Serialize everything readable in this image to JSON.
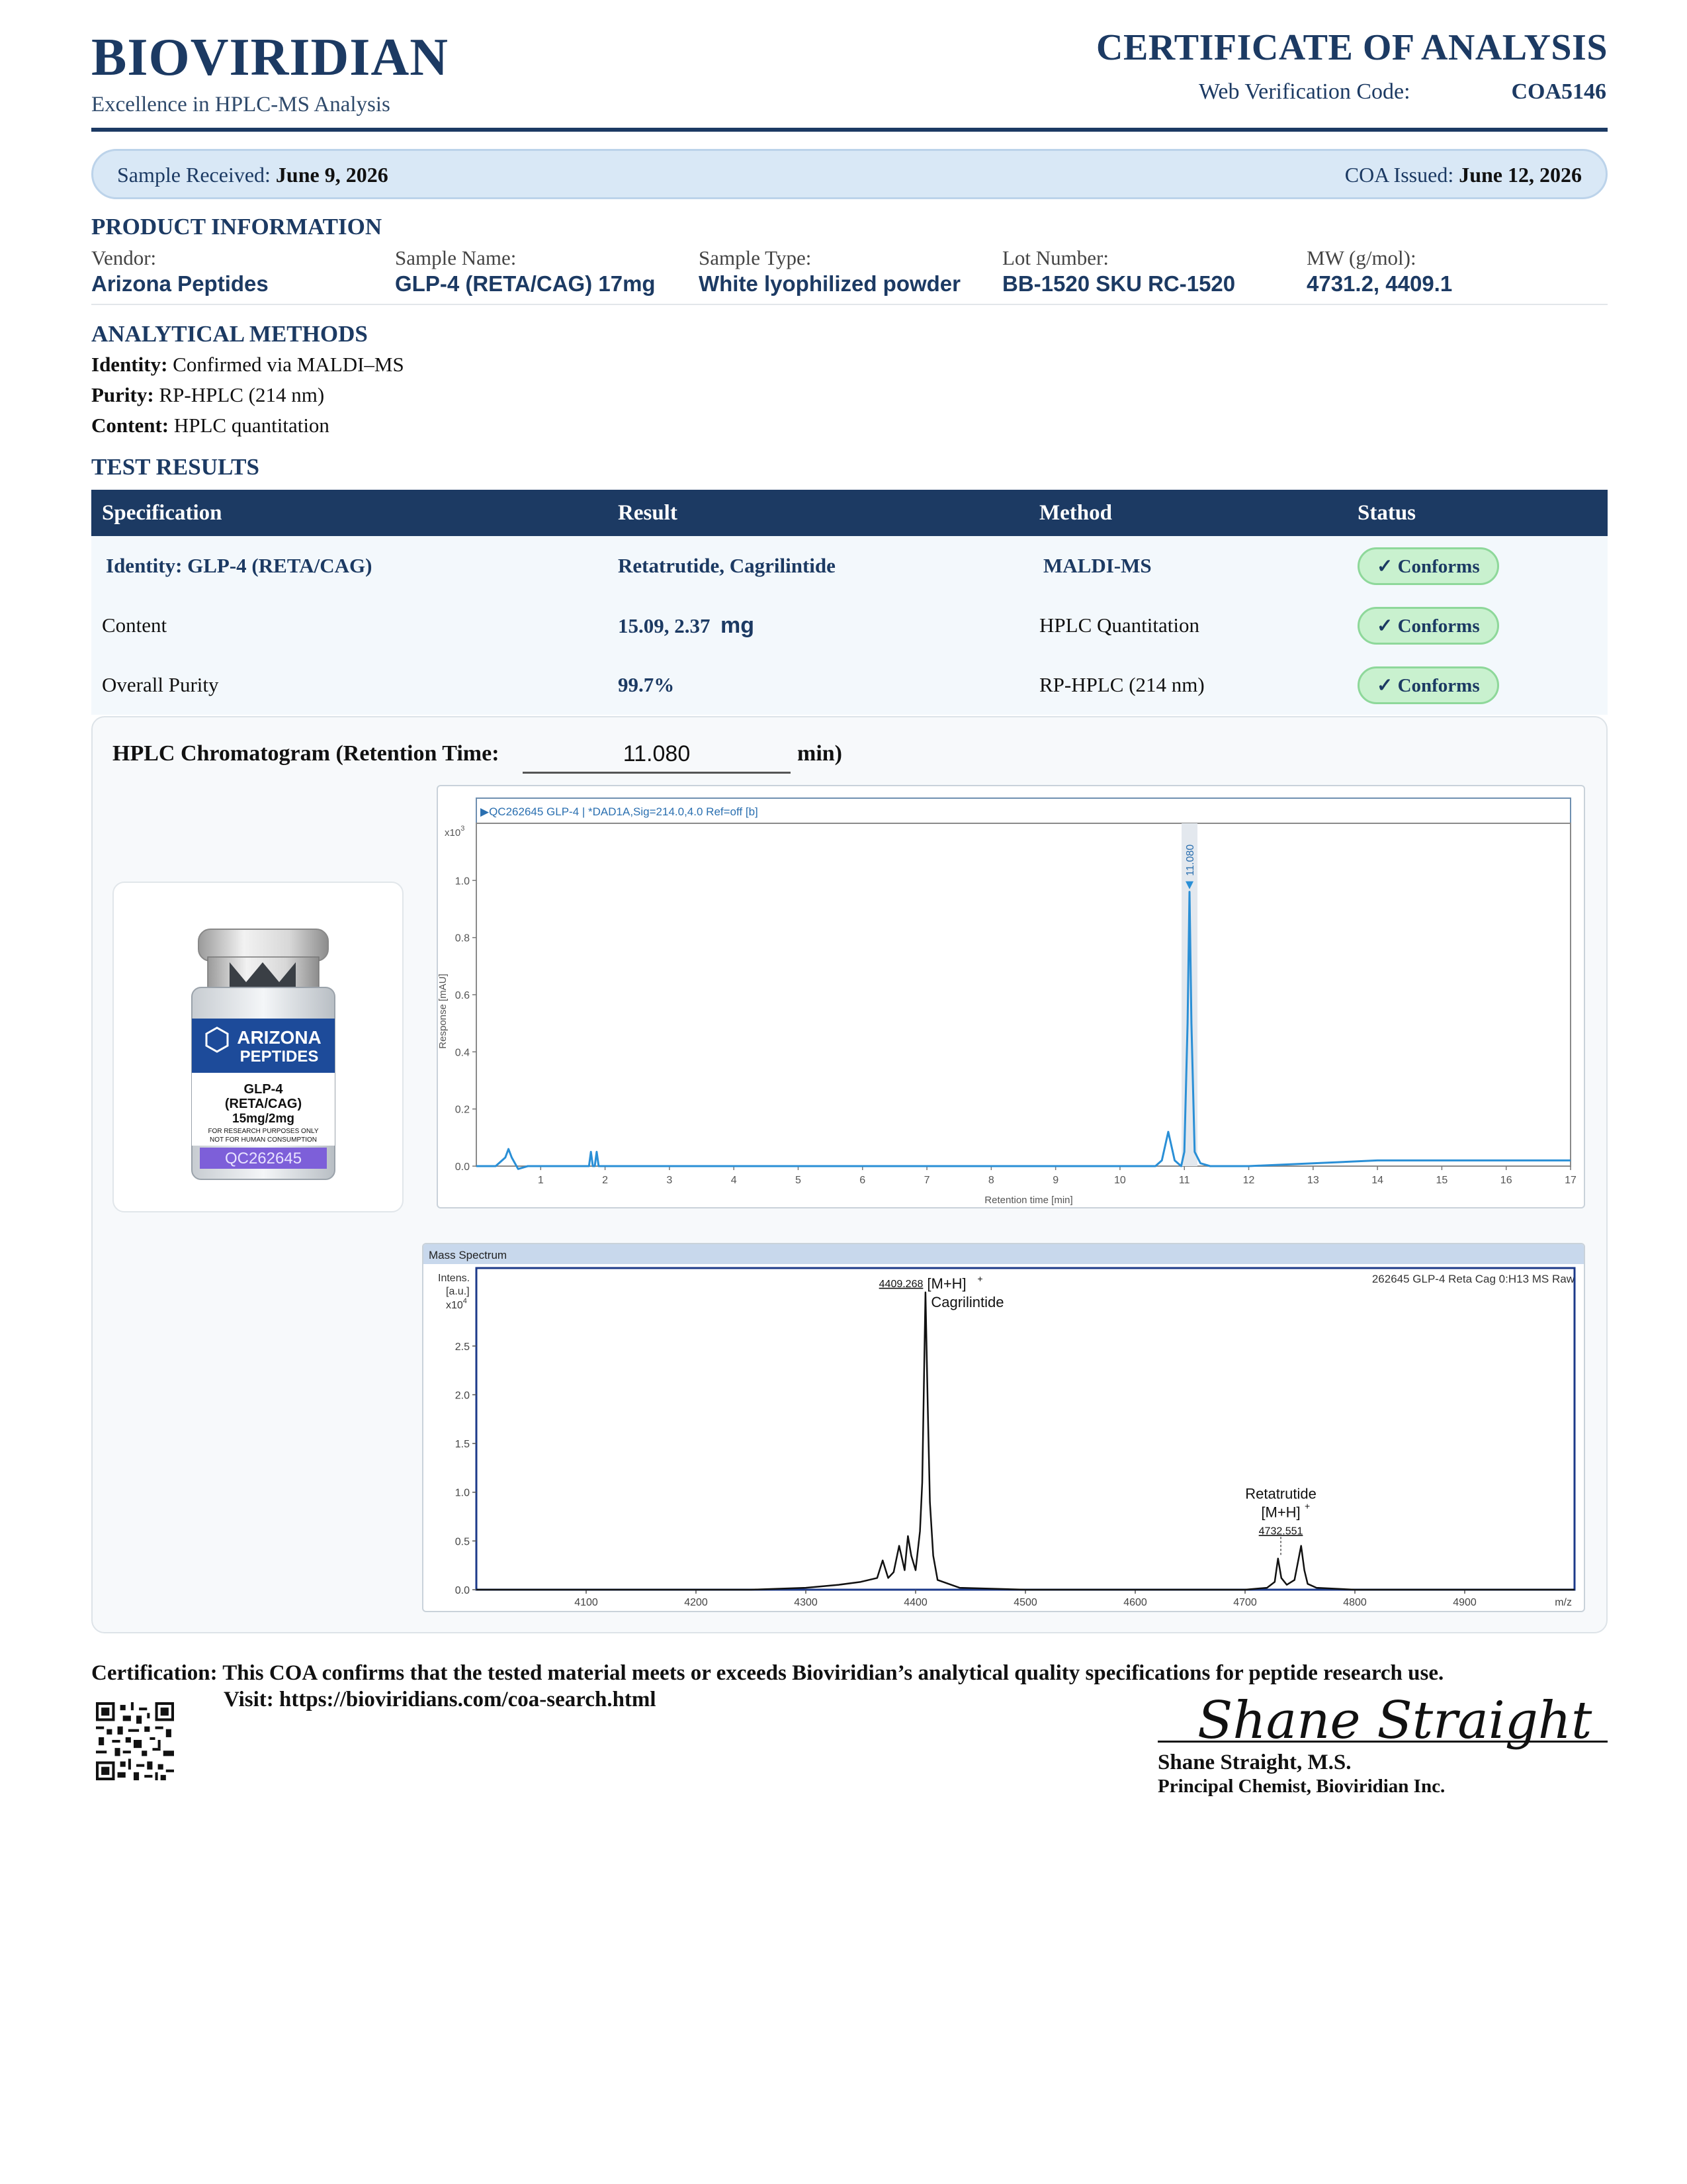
{
  "header": {
    "brand": "BIOVIRIDIAN",
    "tagline": "Excellence in HPLC-MS Analysis",
    "doc_title": "CERTIFICATE OF ANALYSIS",
    "verification_label": "Web Verification Code:",
    "verification_code": "COA5146",
    "brand_color": "#1c3a63"
  },
  "dates": {
    "received_label": "Sample Received:",
    "received_value": "June 9, 2026",
    "issued_label": "COA Issued:",
    "issued_value": "June 12, 2026"
  },
  "product_info": {
    "title": "PRODUCT INFORMATION",
    "fields": [
      {
        "label": "Vendor:",
        "value": "Arizona Peptides"
      },
      {
        "label": "Sample Name:",
        "value": "GLP-4 (RETA/CAG) 17mg"
      },
      {
        "label": "Sample Type:",
        "value": "White lyophilized powder"
      },
      {
        "label": "Lot Number:",
        "value": "BB-1520 SKU RC-1520"
      },
      {
        "label": "MW (g/mol):",
        "value": "4731.2, 4409.1"
      }
    ]
  },
  "methods": {
    "title": "ANALYTICAL METHODS",
    "items": [
      {
        "label": "Identity:",
        "value": "Confirmed via MALDI–MS"
      },
      {
        "label": "Purity:",
        "value": "RP-HPLC (214 nm)"
      },
      {
        "label": "Content:",
        "value": "HPLC quantitation"
      }
    ]
  },
  "results": {
    "title": "TEST RESULTS",
    "headers": [
      "Specification",
      "Result",
      "Method",
      "Status"
    ],
    "rows": [
      {
        "spec": "Identity:  GLP-4 (RETA/CAG)",
        "result": "Retatrutide, Cagrilintide",
        "unit": "",
        "method": "MALDI-MS",
        "status": "Conforms"
      },
      {
        "spec": "Content",
        "result": "15.09, 2.37",
        "unit": "mg",
        "method": "HPLC Quantitation",
        "status": "Conforms"
      },
      {
        "spec": "Overall Purity",
        "result": "99.7%",
        "unit": "",
        "method": "RP-HPLC (214 nm)",
        "status": "Conforms"
      }
    ],
    "check_glyph": "✓",
    "status_color": "#c9f1cf"
  },
  "chromatogram": {
    "title": "HPLC Chromatogram (Retention Time:",
    "retention_time": "11.080",
    "unit": "min)"
  },
  "vial": {
    "brand_line1": "ARIZONA",
    "brand_line2": "PEPTIDES",
    "product_line1": "GLP-4",
    "product_line2": "(RETA/CAG)",
    "dose": "15mg/2mg",
    "disclaimer1": "FOR RESEARCH PURPOSES ONLY",
    "disclaimer2": "NOT FOR HUMAN CONSUMPTION",
    "lot_code": "QC262645"
  },
  "chart_data": [
    {
      "type": "line",
      "header_text": "▶QC262645 GLP-4 | *DAD1A,Sig=214.0,4.0 Ref=off [b]",
      "ylabel": "Response [mAU]",
      "xlabel": "Retention time [min]",
      "y_multiplier": "x10",
      "y_exponent": "3",
      "xlim": [
        0,
        17
      ],
      "ylim": [
        0,
        1.2
      ],
      "x_ticks": [
        1,
        2,
        3,
        4,
        5,
        6,
        7,
        8,
        9,
        10,
        11,
        12,
        13,
        14,
        15,
        16,
        17
      ],
      "y_ticks": [
        0.0,
        0.2,
        0.4,
        0.6,
        0.8,
        1.0
      ],
      "y_tick_labels": [
        "0.0",
        "0.2",
        "0.4",
        "0.6",
        "0.8",
        "1.0"
      ],
      "peak_label": "11.080",
      "line_color": "#2a8fd6",
      "series": [
        {
          "x": [
            0,
            0.3,
            0.45,
            0.5,
            0.55,
            0.65,
            0.8,
            1.5,
            1.75,
            1.78,
            1.81,
            1.84,
            1.87,
            1.9,
            1.95,
            2.5,
            3.5,
            4.5,
            5.5,
            6.5,
            7.5,
            8.5,
            9.5,
            10.3,
            10.55,
            10.65,
            10.75,
            10.85,
            10.95,
            11.0,
            11.05,
            11.08,
            11.11,
            11.16,
            11.25,
            11.4,
            12,
            13,
            14,
            15,
            16,
            17
          ],
          "y": [
            0.0,
            0.0,
            0.03,
            0.06,
            0.03,
            -0.01,
            0.0,
            0.0,
            0.0,
            0.05,
            0.0,
            0.0,
            0.05,
            0.0,
            0.0,
            0.0,
            0.0,
            0.0,
            0.0,
            0.0,
            0.0,
            0.0,
            0.0,
            0.0,
            0.0,
            0.02,
            0.12,
            0.02,
            0.0,
            0.05,
            0.5,
            0.96,
            0.5,
            0.05,
            0.01,
            0.0,
            0.0,
            0.01,
            0.02,
            0.02,
            0.02,
            0.02
          ]
        }
      ]
    },
    {
      "type": "line",
      "header_text": "Mass Spectrum",
      "sample_label": "262645 GLP-4 Reta Cag 0:H13 MS Raw",
      "ylabel_line1": "Intens.",
      "ylabel_line2": "[a.u.]",
      "y_multiplier": "x10",
      "y_exponent": "4",
      "xlabel": "m/z",
      "xlim": [
        4000,
        5000
      ],
      "ylim": [
        0,
        3.3
      ],
      "x_ticks": [
        4100,
        4200,
        4300,
        4400,
        4500,
        4600,
        4700,
        4800,
        4900
      ],
      "y_ticks": [
        0.0,
        0.5,
        1.0,
        1.5,
        2.0,
        2.5
      ],
      "y_tick_labels": [
        "0.0",
        "0.5",
        "1.0",
        "1.5",
        "2.0",
        "2.5"
      ],
      "line_color": "#111111",
      "annotations": [
        {
          "mz": "4409.268",
          "ion": "[M+H]",
          "charge": "+",
          "name": "Cagrilintide",
          "x": 4409.268,
          "y": 3.05
        },
        {
          "mz": "4732.551",
          "ion": "[M+H]",
          "charge": "+",
          "name": "Retatrutide",
          "x": 4732.551,
          "y": 0.5
        }
      ],
      "series": [
        {
          "x": [
            4000,
            4250,
            4300,
            4330,
            4350,
            4365,
            4370,
            4375,
            4380,
            4385,
            4390,
            4393,
            4396,
            4400,
            4404,
            4406,
            4409,
            4411,
            4413,
            4416,
            4420,
            4440,
            4500,
            4600,
            4700,
            4720,
            4727,
            4730,
            4733,
            4738,
            4745,
            4751,
            4754,
            4757,
            4765,
            4800,
            4900,
            5000
          ],
          "y": [
            0.0,
            0.0,
            0.02,
            0.05,
            0.08,
            0.12,
            0.3,
            0.12,
            0.18,
            0.45,
            0.2,
            0.55,
            0.35,
            0.2,
            0.6,
            1.1,
            3.05,
            1.9,
            0.9,
            0.35,
            0.1,
            0.02,
            0.0,
            0.0,
            0.0,
            0.02,
            0.08,
            0.32,
            0.12,
            0.05,
            0.1,
            0.45,
            0.2,
            0.06,
            0.02,
            0.0,
            0.0,
            0.0
          ]
        }
      ]
    }
  ],
  "certification": {
    "text": "Certification: This COA confirms that the tested material meets or exceeds Bioviridian’s analytical quality specifications for peptide research use.",
    "visit": "Visit: https://bioviridians.com/coa-search.html"
  },
  "signature": {
    "script": "Shane Straight",
    "name": "Shane Straight, M.S.",
    "title": "Principal Chemist, Bioviridian Inc."
  }
}
